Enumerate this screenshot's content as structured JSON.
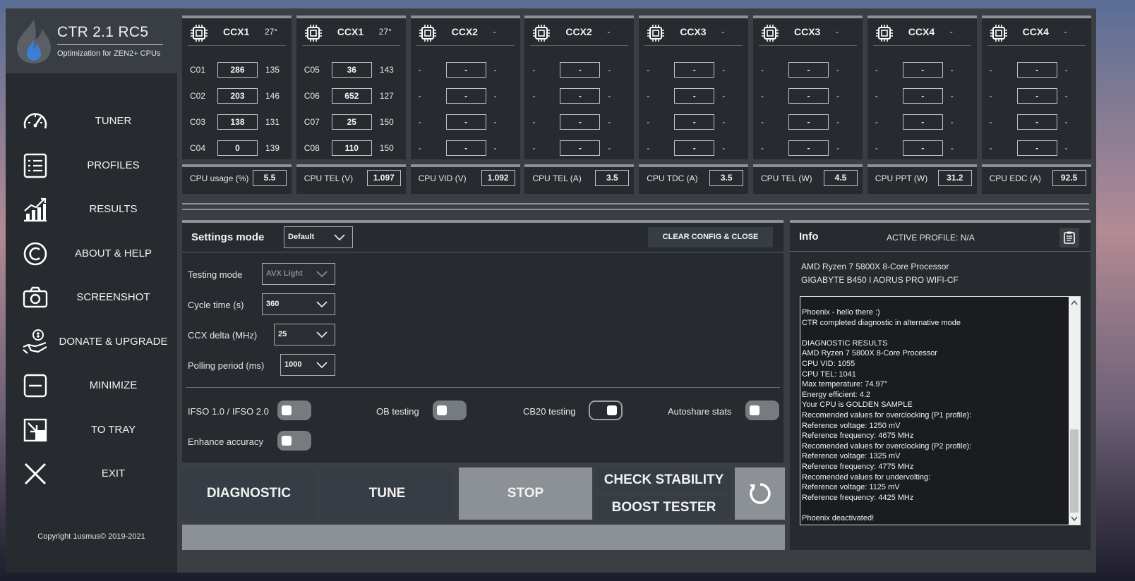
{
  "app": {
    "title": "CTR 2.1 RC5",
    "subtitle": "Optimization for ZEN2+ CPUs",
    "copyright": "Copyright 1usmus© 2019-2021"
  },
  "nav": [
    {
      "label": "TUNER",
      "icon": "speedometer-icon"
    },
    {
      "label": "PROFILES",
      "icon": "list-icon"
    },
    {
      "label": "RESULTS",
      "icon": "bar-chart-icon"
    },
    {
      "label": "ABOUT & HELP",
      "icon": "copyright-icon"
    },
    {
      "label": "SCREENSHOT",
      "icon": "camera-icon"
    },
    {
      "label": "DONATE & UPGRADE",
      "icon": "donate-hand-icon"
    },
    {
      "label": "MINIMIZE",
      "icon": "minimize-icon"
    },
    {
      "label": "TO TRAY",
      "icon": "to-tray-icon"
    },
    {
      "label": "EXIT",
      "icon": "close-icon"
    }
  ],
  "ccx": [
    {
      "name": "CCX1",
      "temp": "27°",
      "cores": [
        {
          "id": "C01",
          "val": "286",
          "freq": "135"
        },
        {
          "id": "C02",
          "val": "203",
          "freq": "146"
        },
        {
          "id": "C03",
          "val": "138",
          "freq": "131"
        },
        {
          "id": "C04",
          "val": "0",
          "freq": "139"
        }
      ]
    },
    {
      "name": "CCX1",
      "temp": "27°",
      "cores": [
        {
          "id": "C05",
          "val": "36",
          "freq": "143"
        },
        {
          "id": "C06",
          "val": "652",
          "freq": "127"
        },
        {
          "id": "C07",
          "val": "25",
          "freq": "150"
        },
        {
          "id": "C08",
          "val": "110",
          "freq": "150"
        }
      ]
    },
    {
      "name": "CCX2",
      "temp": "-",
      "cores": [
        {
          "id": "-",
          "val": "-",
          "freq": "-"
        },
        {
          "id": "-",
          "val": "-",
          "freq": "-"
        },
        {
          "id": "-",
          "val": "-",
          "freq": "-"
        },
        {
          "id": "-",
          "val": "-",
          "freq": "-"
        }
      ]
    },
    {
      "name": "CCX2",
      "temp": "-",
      "cores": [
        {
          "id": "-",
          "val": "-",
          "freq": "-"
        },
        {
          "id": "-",
          "val": "-",
          "freq": "-"
        },
        {
          "id": "-",
          "val": "-",
          "freq": "-"
        },
        {
          "id": "-",
          "val": "-",
          "freq": "-"
        }
      ]
    },
    {
      "name": "CCX3",
      "temp": "-",
      "cores": [
        {
          "id": "-",
          "val": "-",
          "freq": "-"
        },
        {
          "id": "-",
          "val": "-",
          "freq": "-"
        },
        {
          "id": "-",
          "val": "-",
          "freq": "-"
        },
        {
          "id": "-",
          "val": "-",
          "freq": "-"
        }
      ]
    },
    {
      "name": "CCX3",
      "temp": "-",
      "cores": [
        {
          "id": "-",
          "val": "-",
          "freq": "-"
        },
        {
          "id": "-",
          "val": "-",
          "freq": "-"
        },
        {
          "id": "-",
          "val": "-",
          "freq": "-"
        },
        {
          "id": "-",
          "val": "-",
          "freq": "-"
        }
      ]
    },
    {
      "name": "CCX4",
      "temp": "-",
      "cores": [
        {
          "id": "-",
          "val": "-",
          "freq": "-"
        },
        {
          "id": "-",
          "val": "-",
          "freq": "-"
        },
        {
          "id": "-",
          "val": "-",
          "freq": "-"
        },
        {
          "id": "-",
          "val": "-",
          "freq": "-"
        }
      ]
    },
    {
      "name": "CCX4",
      "temp": "-",
      "cores": [
        {
          "id": "-",
          "val": "-",
          "freq": "-"
        },
        {
          "id": "-",
          "val": "-",
          "freq": "-"
        },
        {
          "id": "-",
          "val": "-",
          "freq": "-"
        },
        {
          "id": "-",
          "val": "-",
          "freq": "-"
        }
      ]
    }
  ],
  "stats": [
    {
      "label": "CPU usage (%)",
      "value": "5.5"
    },
    {
      "label": "CPU TEL (V)",
      "value": "1.097"
    },
    {
      "label": "CPU VID (V)",
      "value": "1.092"
    },
    {
      "label": "CPU TEL (A)",
      "value": "3.5"
    },
    {
      "label": "CPU TDC (A)",
      "value": "3.5"
    },
    {
      "label": "CPU TEL (W)",
      "value": "4.5"
    },
    {
      "label": "CPU PPT (W)",
      "value": "31.2"
    },
    {
      "label": "CPU EDC (A)",
      "value": "92.5"
    }
  ],
  "settings": {
    "title": "Settings mode",
    "mode_value": "Default",
    "clear_button": "CLEAR CONFIG & CLOSE",
    "testing_mode_label": "Testing mode",
    "testing_mode_value": "AVX Light",
    "cycle_label": "Cycle time (s)",
    "cycle_value": "360",
    "ccx_delta_label": "CCX delta (MHz)",
    "ccx_delta_value": "25",
    "polling_label": "Polling period (ms)",
    "polling_value": "1000",
    "toggles": {
      "ifso": {
        "label": "IFSO 1.0 / IFSO 2.0",
        "on": false
      },
      "ob": {
        "label": "OB testing",
        "on": false
      },
      "cb20": {
        "label": "CB20 testing",
        "on": true
      },
      "autoshare": {
        "label": "Autoshare stats",
        "on": false
      },
      "enhance": {
        "label": "Enhance accuracy",
        "on": false
      }
    }
  },
  "buttons": {
    "diagnostic": "DIAGNOSTIC",
    "tune": "TUNE",
    "stop": "STOP",
    "check_stability": "CHECK STABILITY",
    "boost_tester": "BOOST TESTER"
  },
  "info": {
    "title": "Info",
    "active_profile": "ACTIVE PROFILE: N/A",
    "cpu": "AMD Ryzen 7 5800X 8-Core Processor",
    "board": "GIGABYTE B450 I AORUS PRO WIFI-CF",
    "log": [
      "Phoenix - hello there :)",
      "CTR completed diagnostic in alternative mode",
      "",
      "DIAGNOSTIC RESULTS",
      "AMD Ryzen 7 5800X 8-Core Processor",
      "CPU VID: 1055",
      "CPU TEL: 1041",
      "Max temperature: 74.97°",
      "Energy efficient: 4.2",
      "Your CPU is GOLDEN SAMPLE",
      "Recomended values for overclocking (P1 profile):",
      "Reference voltage: 1250 mV",
      "Reference frequency: 4675 MHz",
      "Recomended values for overclocking (P2 profile):",
      "Reference voltage: 1325 mV",
      "Reference frequency: 4775 MHz",
      "Recomended values for undervolting:",
      "Reference voltage: 1125 mV",
      "Reference frequency: 4425 MHz",
      "",
      "Phoenix deactivated!"
    ]
  },
  "colors": {
    "background": "#3b3f44",
    "panel": "#272a2e",
    "accent_bar": "#8c9196",
    "stop_button": "#8c9196"
  }
}
